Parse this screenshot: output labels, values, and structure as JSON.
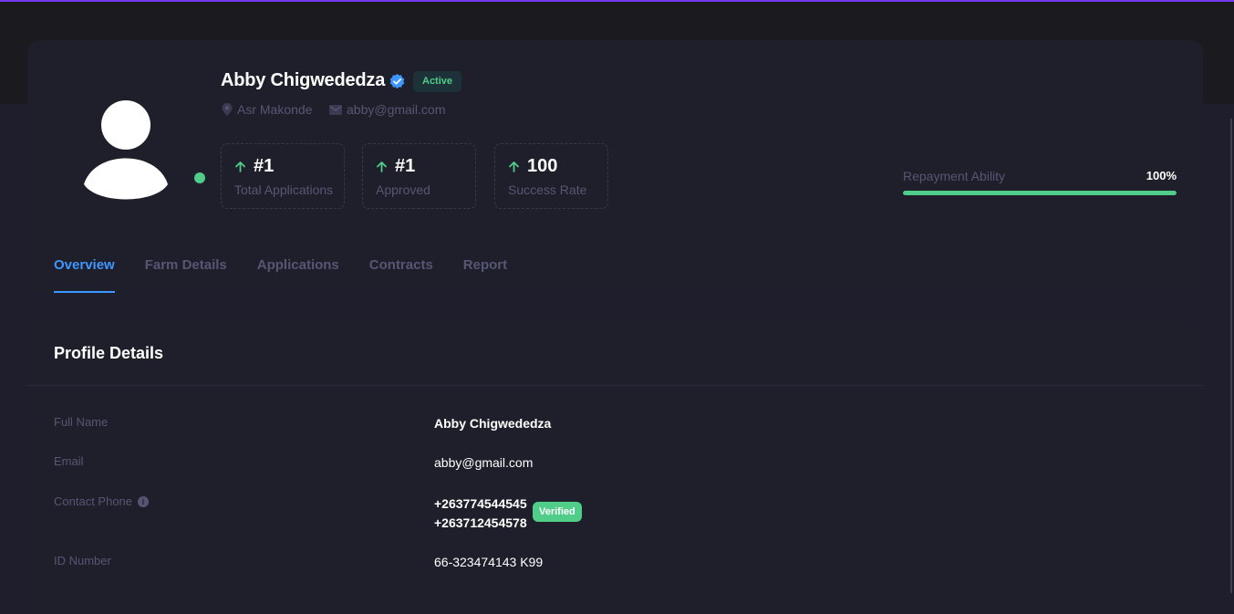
{
  "profile": {
    "name": "Abby Chigwededza",
    "status": "Active",
    "location": "Asr Makonde",
    "email": "abby@gmail.com"
  },
  "stats": [
    {
      "value": "#1",
      "label": "Total Applications"
    },
    {
      "value": "#1",
      "label": "Approved"
    },
    {
      "value": "100",
      "label": "Success Rate"
    }
  ],
  "repayment": {
    "label": "Repayment Ability",
    "value_text": "100%",
    "fraction": 1.0
  },
  "tabs": [
    "Overview",
    "Farm Details",
    "Applications",
    "Contracts",
    "Report"
  ],
  "details": {
    "title": "Profile Details",
    "full_name_label": "Full Name",
    "full_name": "Abby Chigwededza",
    "email_label": "Email",
    "email": "abby@gmail.com",
    "phone_label": "Contact Phone",
    "phone_1": "+263774544545",
    "phone_2": "+263712454578",
    "phone_badge": "Verified",
    "id_label": "ID Number",
    "id_number": "66-323474143 K99"
  },
  "colors": {
    "accent": "#3e97ff",
    "success": "#50cd89",
    "top_line": "#7239ea"
  }
}
